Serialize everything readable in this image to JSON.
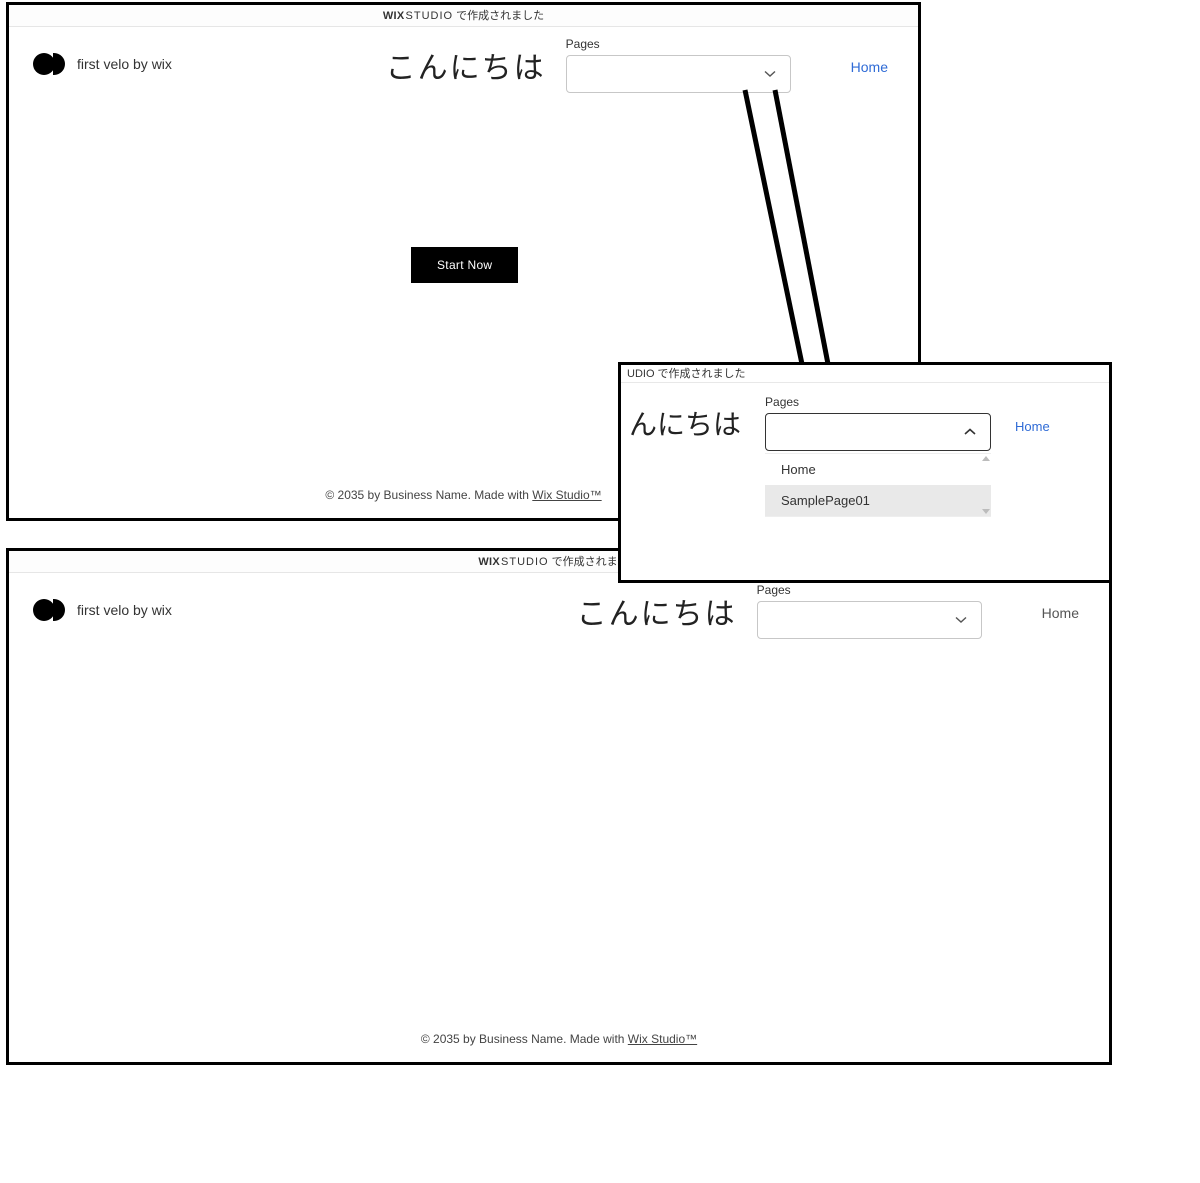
{
  "topbar": {
    "wix": "WIX",
    "studio": "STUDIO",
    "suffix": "で作成されました"
  },
  "site": {
    "title": "first velo by wix"
  },
  "greeting": "こんにちは",
  "greeting_partial": "んにちは",
  "pages": {
    "label": "Pages"
  },
  "nav": {
    "home": "Home"
  },
  "cta": {
    "start_now": "Start Now"
  },
  "footer": {
    "prefix": "© 2035 by Business Name. Made with ",
    "link": "Wix Studio™"
  },
  "detail": {
    "topbar_partial": "UDIO で作成されました",
    "options": [
      "Home",
      "SamplePage01"
    ]
  }
}
